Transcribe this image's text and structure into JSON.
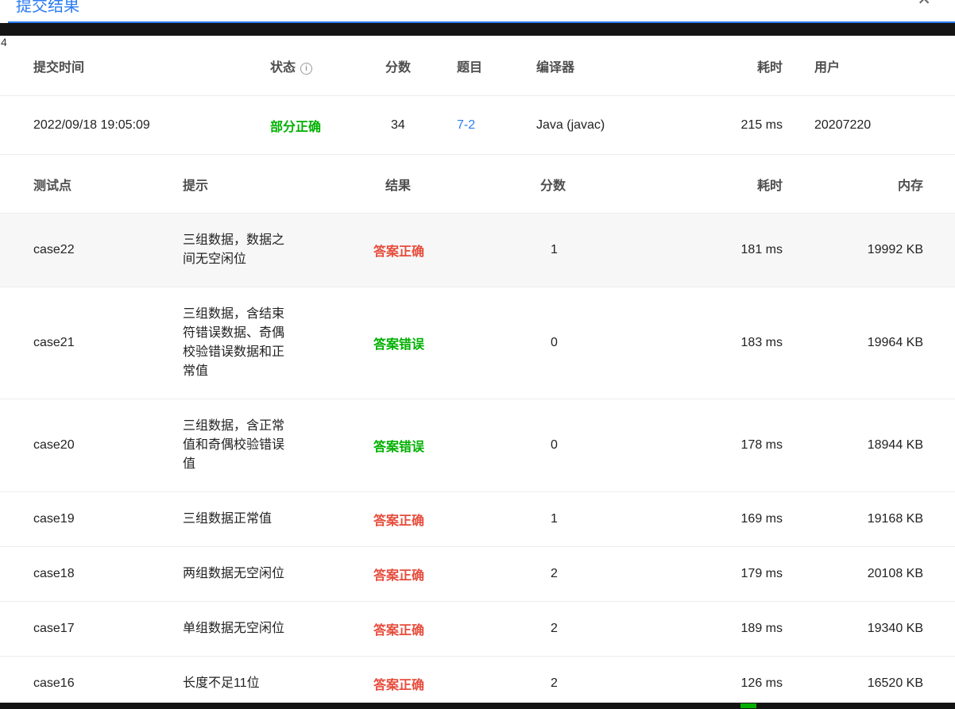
{
  "modal": {
    "title": "提交结果",
    "close_icon": "✕"
  },
  "background_fragments": {
    "left_edge_text": "4"
  },
  "summary_table": {
    "headers": [
      "提交时间",
      "状态",
      "分数",
      "题目",
      "编译器",
      "耗时",
      "用户"
    ],
    "status_info_icon": "i",
    "row": {
      "submit_time": "2022/09/18 19:05:09",
      "status": "部分正确",
      "score": "34",
      "problem": "7-2",
      "compiler": "Java (javac)",
      "time": "215 ms",
      "user": "20207220"
    }
  },
  "cases_table": {
    "headers": [
      "测试点",
      "提示",
      "结果",
      "分数",
      "耗时",
      "内存"
    ],
    "rows": [
      {
        "case": "case22",
        "hint": "三组数据，数据之间无空闲位",
        "result": "答案正确",
        "result_color": "red",
        "score": "1",
        "time": "181 ms",
        "memory": "19992 KB",
        "highlight": true
      },
      {
        "case": "case21",
        "hint": "三组数据，含结束符错误数据、奇偶校验错误数据和正常值",
        "result": "答案错误",
        "result_color": "green",
        "score": "0",
        "time": "183 ms",
        "memory": "19964 KB",
        "highlight": false
      },
      {
        "case": "case20",
        "hint": "三组数据，含正常值和奇偶校验错误值",
        "result": "答案错误",
        "result_color": "green",
        "score": "0",
        "time": "178 ms",
        "memory": "18944 KB",
        "highlight": false
      },
      {
        "case": "case19",
        "hint": "三组数据正常值",
        "result": "答案正确",
        "result_color": "red",
        "score": "1",
        "time": "169 ms",
        "memory": "19168 KB",
        "highlight": false
      },
      {
        "case": "case18",
        "hint": "两组数据无空闲位",
        "result": "答案正确",
        "result_color": "red",
        "score": "2",
        "time": "179 ms",
        "memory": "20108 KB",
        "highlight": false
      },
      {
        "case": "case17",
        "hint": "单组数据无空闲位",
        "result": "答案正确",
        "result_color": "red",
        "score": "2",
        "time": "189 ms",
        "memory": "19340 KB",
        "highlight": false
      },
      {
        "case": "case16",
        "hint": "长度不足11位",
        "result": "答案正确",
        "result_color": "red",
        "score": "2",
        "time": "126 ms",
        "memory": "16520 KB",
        "highlight": false
      }
    ]
  },
  "colors": {
    "accent_blue": "#2b7cf2",
    "success_green": "#00b000",
    "alert_red": "#e74c3c",
    "page_band": "#141414",
    "row_highlight": "#f7f7f7",
    "border": "#ececec"
  }
}
